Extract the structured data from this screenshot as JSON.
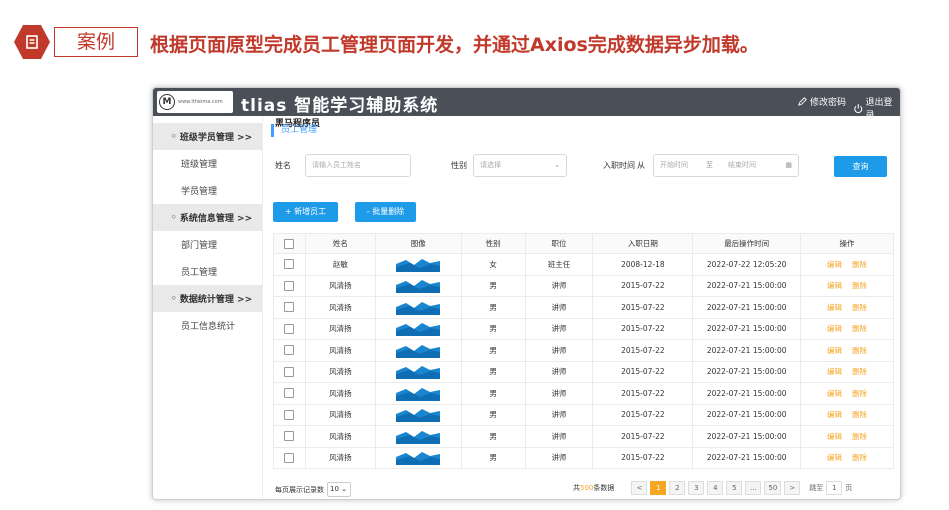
{
  "slide": {
    "badge_label": "案例",
    "title": "根据页面原型完成员工管理页面开发，并通过Axios完成数据异步加载。"
  },
  "header": {
    "logo_main": "黑马程序员",
    "logo_sub": "www.itheima.com",
    "app_title": "tlias 智能学习辅助系统",
    "change_password": "修改密码",
    "logout": "退出登录"
  },
  "sidebar": {
    "groups": [
      {
        "label": "班级学员管理  >>",
        "items": [
          "班级管理",
          "学员管理"
        ]
      },
      {
        "label": "系统信息管理  >>",
        "items": [
          "部门管理",
          "员工管理"
        ]
      },
      {
        "label": "数据统计管理  >>",
        "items": [
          "员工信息统计"
        ]
      }
    ]
  },
  "main": {
    "breadcrumb": "员工管理",
    "search": {
      "name_label": "姓名",
      "name_placeholder": "请输入员工姓名",
      "gender_label": "性别",
      "gender_placeholder": "请选择",
      "date_label": "入职时间",
      "date_from_label": "从",
      "date_start_placeholder": "开始时间",
      "date_sep": "至",
      "date_end_placeholder": "结束时间",
      "query_button": "查询"
    },
    "actions": {
      "add": "+ 新增员工",
      "batch_delete": "- 批量删除"
    },
    "table": {
      "columns": [
        "姓名",
        "图像",
        "性别",
        "职位",
        "入职日期",
        "最后操作时间",
        "操作"
      ],
      "edit_label": "编辑",
      "delete_label": "删除",
      "rows": [
        {
          "name": "赵敏",
          "gender": "女",
          "job": "班主任",
          "entry": "2008-12-18",
          "updated": "2022-07-22 12:05:20"
        },
        {
          "name": "风清扬",
          "gender": "男",
          "job": "讲师",
          "entry": "2015-07-22",
          "updated": "2022-07-21 15:00:00"
        },
        {
          "name": "风清扬",
          "gender": "男",
          "job": "讲师",
          "entry": "2015-07-22",
          "updated": "2022-07-21 15:00:00"
        },
        {
          "name": "风清扬",
          "gender": "男",
          "job": "讲师",
          "entry": "2015-07-22",
          "updated": "2022-07-21 15:00:00"
        },
        {
          "name": "风清扬",
          "gender": "男",
          "job": "讲师",
          "entry": "2015-07-22",
          "updated": "2022-07-21 15:00:00"
        },
        {
          "name": "风清扬",
          "gender": "男",
          "job": "讲师",
          "entry": "2015-07-22",
          "updated": "2022-07-21 15:00:00"
        },
        {
          "name": "风清扬",
          "gender": "男",
          "job": "讲师",
          "entry": "2015-07-22",
          "updated": "2022-07-21 15:00:00"
        },
        {
          "name": "风清扬",
          "gender": "男",
          "job": "讲师",
          "entry": "2015-07-22",
          "updated": "2022-07-21 15:00:00"
        },
        {
          "name": "风清扬",
          "gender": "男",
          "job": "讲师",
          "entry": "2015-07-22",
          "updated": "2022-07-21 15:00:00"
        },
        {
          "name": "风清扬",
          "gender": "男",
          "job": "讲师",
          "entry": "2015-07-22",
          "updated": "2022-07-21 15:00:00"
        }
      ]
    },
    "pagination": {
      "page_size_label": "每页展示记录数",
      "page_size": "10",
      "total_prefix": "共",
      "total_count": "500",
      "total_suffix": "条数据",
      "prev": "<",
      "pages": [
        "1",
        "2",
        "3",
        "4",
        "5",
        "...",
        "50"
      ],
      "active_page": "1",
      "next": ">",
      "jump_label": "跳至",
      "jump_value": "1",
      "page_unit": "页"
    }
  },
  "colors": {
    "accent_red": "#c0392b",
    "primary_blue": "#1e9be8",
    "topbar": "#4a4f58",
    "action_orange": "#f5a623"
  }
}
